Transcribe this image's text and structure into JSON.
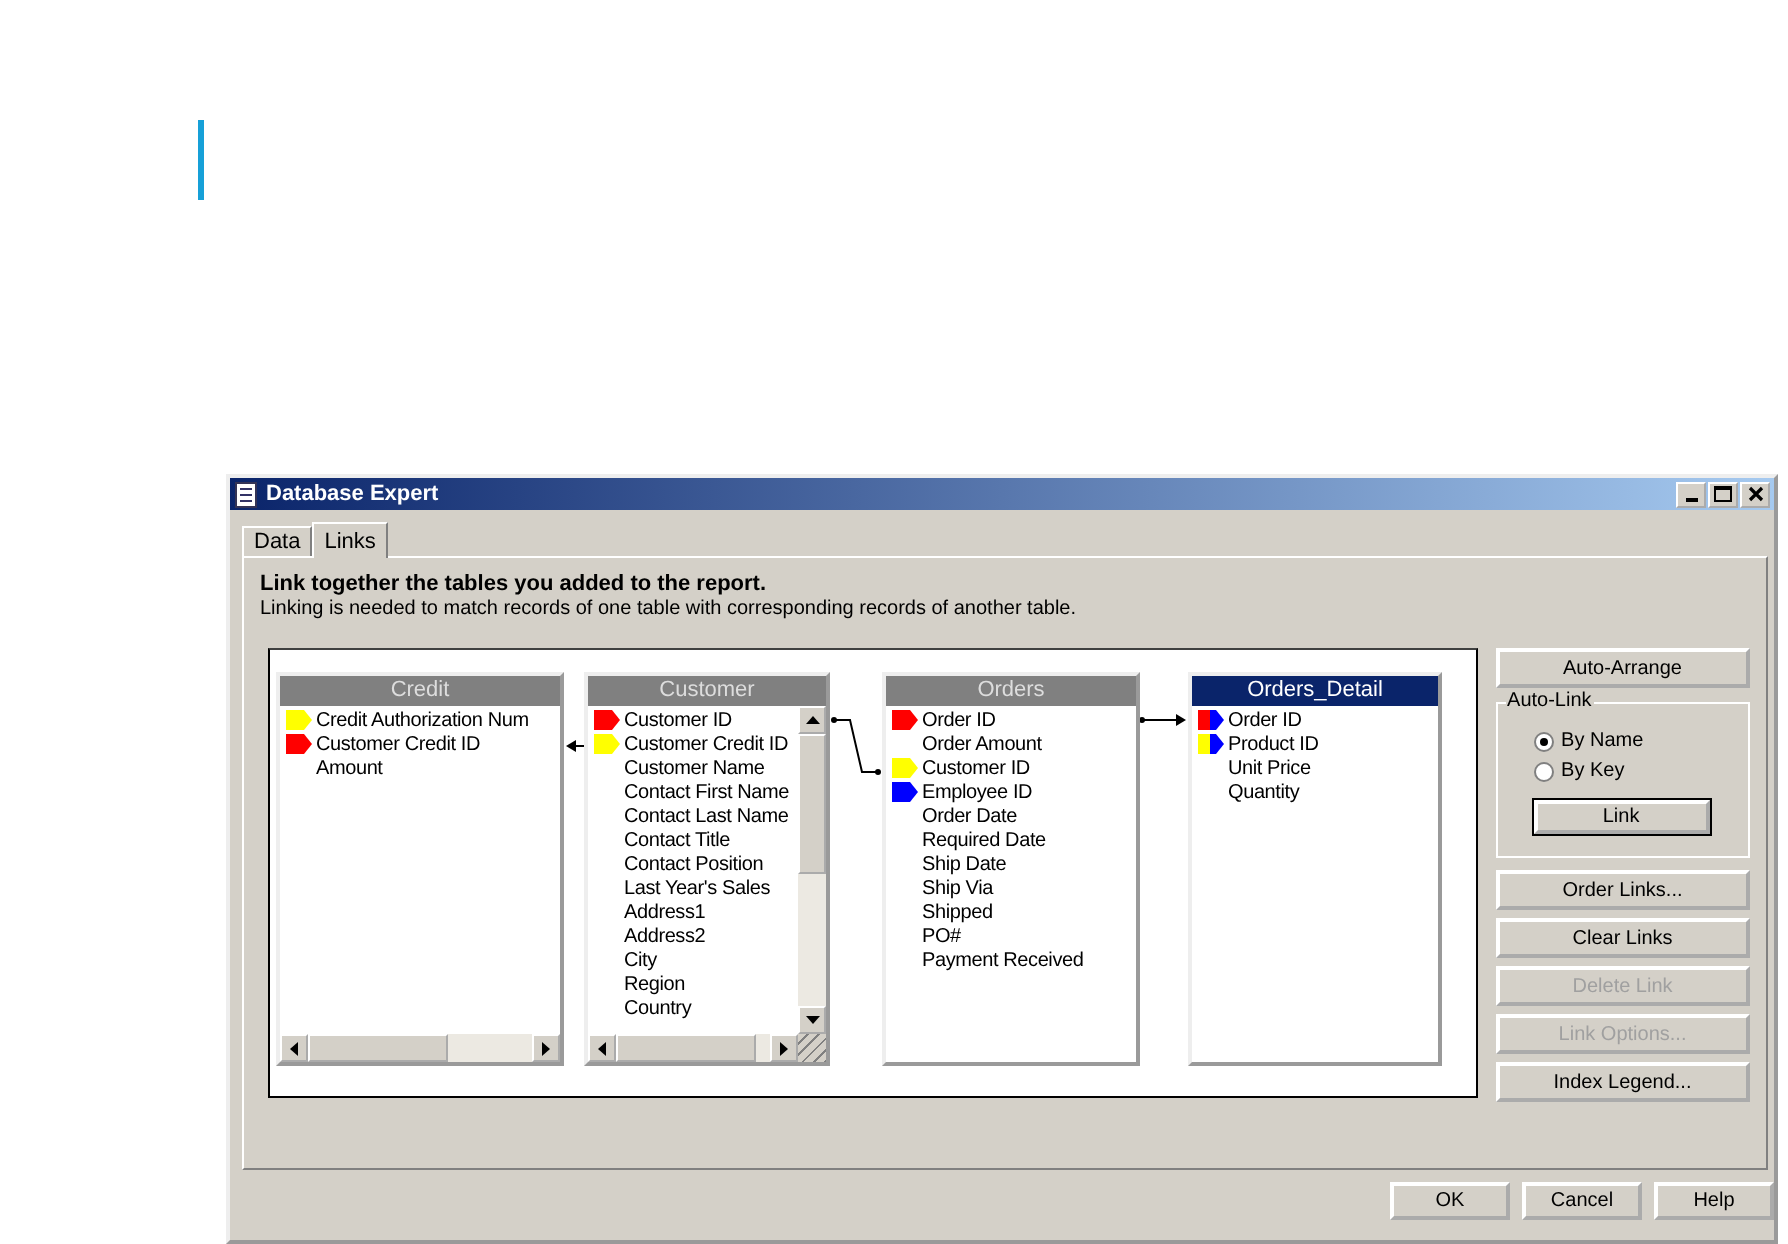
{
  "window": {
    "title": "Database Expert"
  },
  "tabs": [
    {
      "label": "Data",
      "selected": false
    },
    {
      "label": "Links",
      "selected": true
    }
  ],
  "heading": "Link together the tables you added to the report.",
  "description": "Linking is needed to match records of one table with corresponding records of another table.",
  "tables": [
    {
      "name": "Credit",
      "selected": false,
      "horizontal_scrollbar": true,
      "vertical_scrollbar": false,
      "fields": [
        {
          "name": "Credit Authorization Num",
          "color": "#ffff00",
          "indexed": false
        },
        {
          "name": "Customer Credit ID",
          "color": "#ff0000",
          "indexed": false
        },
        {
          "name": "Amount"
        }
      ]
    },
    {
      "name": "Customer",
      "selected": false,
      "horizontal_scrollbar": true,
      "vertical_scrollbar": true,
      "fields": [
        {
          "name": "Customer ID",
          "color": "#ff0000",
          "indexed": false
        },
        {
          "name": "Customer Credit ID",
          "color": "#ffff00",
          "indexed": false
        },
        {
          "name": "Customer Name"
        },
        {
          "name": "Contact First Name"
        },
        {
          "name": "Contact Last Name"
        },
        {
          "name": "Contact Title"
        },
        {
          "name": "Contact Position"
        },
        {
          "name": "Last Year's Sales"
        },
        {
          "name": "Address1"
        },
        {
          "name": "Address2"
        },
        {
          "name": "City"
        },
        {
          "name": "Region"
        },
        {
          "name": "Country"
        }
      ]
    },
    {
      "name": "Orders",
      "selected": false,
      "horizontal_scrollbar": false,
      "vertical_scrollbar": false,
      "fields": [
        {
          "name": "Order ID",
          "color": "#ff0000",
          "indexed": false
        },
        {
          "name": "Order Amount"
        },
        {
          "name": "Customer ID",
          "color": "#ffff00",
          "indexed": false
        },
        {
          "name": "Employee ID",
          "color": "#0000ff",
          "indexed": false
        },
        {
          "name": "Order Date"
        },
        {
          "name": "Required Date"
        },
        {
          "name": "Ship Date"
        },
        {
          "name": "Ship Via"
        },
        {
          "name": "Shipped"
        },
        {
          "name": "PO#"
        },
        {
          "name": "Payment Received"
        }
      ]
    },
    {
      "name": "Orders_Detail",
      "selected": true,
      "horizontal_scrollbar": false,
      "vertical_scrollbar": false,
      "fields": [
        {
          "name": "Order ID",
          "color": "#ff0000",
          "indexed": true
        },
        {
          "name": "Product ID",
          "color": "#ffff00",
          "indexed": true
        },
        {
          "name": "Unit Price"
        },
        {
          "name": "Quantity"
        }
      ]
    }
  ],
  "auto_arrange": "Auto-Arrange",
  "auto_link": {
    "title": "Auto-Link",
    "options": [
      {
        "label": "By Name",
        "selected": true
      },
      {
        "label": "By Key",
        "selected": false
      }
    ],
    "button": "Link"
  },
  "side_buttons": [
    {
      "label": "Order Links...",
      "disabled": false
    },
    {
      "label": "Clear Links",
      "disabled": false
    },
    {
      "label": "Delete Link",
      "disabled": true
    },
    {
      "label": "Link Options...",
      "disabled": true
    },
    {
      "label": "Index Legend...",
      "disabled": false
    }
  ],
  "footer_buttons": [
    "OK",
    "Cancel",
    "Help"
  ]
}
